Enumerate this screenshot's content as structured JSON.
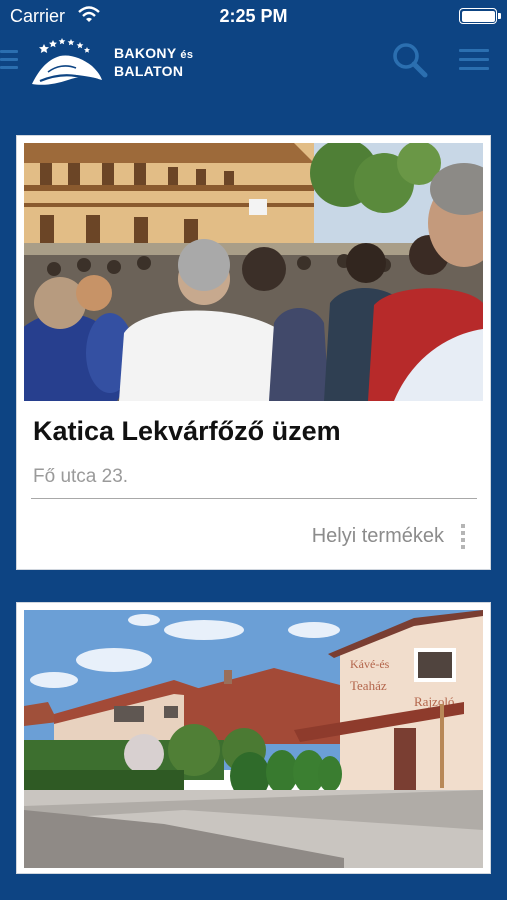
{
  "status_bar": {
    "carrier": "Carrier",
    "time": "2:25 PM",
    "wifi_icon": "wifi-icon",
    "battery_icon": "battery-icon"
  },
  "nav_bar": {
    "logo_line1": "BAKONY",
    "logo_line1_suffix": "és",
    "logo_line2": "BALATON",
    "left_icon": "hamburger-menu-icon",
    "search_icon": "search-icon",
    "right_icon": "hamburger-menu-icon",
    "accent_color": "#2b6fb0"
  },
  "colors": {
    "background": "#0d4483",
    "card": "#ffffff",
    "title": "#111111",
    "muted": "#9a9a9a"
  },
  "listings": [
    {
      "title": "Katica Lekvárfőző üzem",
      "address": "Fő utca 23.",
      "category": "Helyi termékek",
      "photo": "outdoor crowd in front of a two-storey building"
    },
    {
      "photo": "street view of a building with signs Kávé-és Teaház, Rajzoló",
      "sign_lines": [
        "Kávé-és",
        "Teaház",
        "Rajzoló"
      ]
    }
  ]
}
